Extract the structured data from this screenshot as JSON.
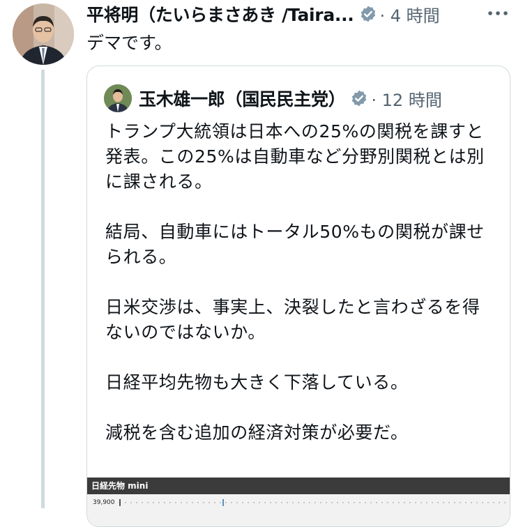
{
  "tweet": {
    "author_name": "平将明（たいらまさあき /Taira...",
    "time": "· 4 時間",
    "text": "デマです。"
  },
  "quoted": {
    "author_name": "玉木雄一郎（国民民主党）",
    "time": "· 12 時間",
    "paragraphs": [
      "トランプ大統領は日本への25%の関税を課すと発表。この25%は自動車など分野別関税とは別に課される。",
      "結局、自動車にはトータル50%もの関税が課せられる。",
      "日米交渉は、事実上、決裂したと言わざるを得ないのではないか。",
      "日経平均先物も大きく下落している。",
      "減税を含む追加の経済対策が必要だ。"
    ],
    "chart": {
      "title": "日経先物 mini",
      "tick_label": "39,900"
    }
  },
  "icons": {
    "verified": "verified-badge-icon",
    "more": "more-options-icon"
  },
  "colors": {
    "verified_gray": "#829aab",
    "meta_text": "#536471",
    "thread_line": "#cfd9de"
  }
}
